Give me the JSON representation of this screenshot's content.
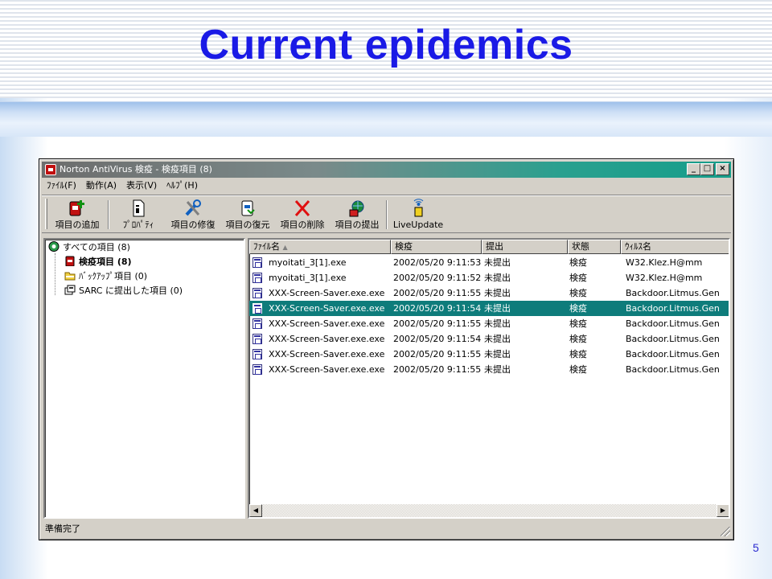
{
  "slide": {
    "title": "Current epidemics",
    "page_number": "5"
  },
  "window": {
    "title": "Norton AntiVirus 検疫 - 検疫項目 (8)",
    "controls": {
      "minimize": "_",
      "maximize": "□",
      "close": "×"
    }
  },
  "menu": [
    {
      "label": "ﾌｧｲﾙ(F)"
    },
    {
      "label": "動作(A)"
    },
    {
      "label": "表示(V)"
    },
    {
      "label": "ﾍﾙﾌﾟ(H)"
    }
  ],
  "toolbar": {
    "add": "項目の追加",
    "properties": "ﾌﾟﾛﾊﾟﾃｨ",
    "repair": "項目の修復",
    "restore": "項目の復元",
    "delete": "項目の削除",
    "submit": "項目の提出",
    "liveupdate": "LiveUpdate"
  },
  "tree": [
    {
      "label": "すべての項目 (8)",
      "icon": "all-items-icon"
    },
    {
      "label": "検疫項目 (8)",
      "icon": "quarantine-icon"
    },
    {
      "label": "ﾊﾞｯｸｱｯﾌﾟ項目 (0)",
      "icon": "backup-folder-icon"
    },
    {
      "label": "SARC に提出した項目 (0)",
      "icon": "submitted-icon"
    }
  ],
  "list": {
    "columns": [
      "ﾌｧｲﾙ名",
      "検疫",
      "提出",
      "状態",
      "ｳｨﾙｽ名"
    ],
    "sort_indicator": "▲",
    "rows": [
      {
        "file": "myoitati_3[1].exe",
        "date": "2002/05/20 9:11:53",
        "submitted": "未提出",
        "status": "検疫",
        "virus": "W32.Klez.H@mm",
        "selected": false
      },
      {
        "file": "myoitati_3[1].exe",
        "date": "2002/05/20 9:11:52",
        "submitted": "未提出",
        "status": "検疫",
        "virus": "W32.Klez.H@mm",
        "selected": false
      },
      {
        "file": "XXX-Screen-Saver.exe.exe",
        "date": "2002/05/20 9:11:55",
        "submitted": "未提出",
        "status": "検疫",
        "virus": "Backdoor.Litmus.Gen",
        "selected": false
      },
      {
        "file": "XXX-Screen-Saver.exe.exe",
        "date": "2002/05/20 9:11:54",
        "submitted": "未提出",
        "status": "検疫",
        "virus": "Backdoor.Litmus.Gen",
        "selected": true
      },
      {
        "file": "XXX-Screen-Saver.exe.exe",
        "date": "2002/05/20 9:11:55",
        "submitted": "未提出",
        "status": "検疫",
        "virus": "Backdoor.Litmus.Gen",
        "selected": false
      },
      {
        "file": "XXX-Screen-Saver.exe.exe",
        "date": "2002/05/20 9:11:54",
        "submitted": "未提出",
        "status": "検疫",
        "virus": "Backdoor.Litmus.Gen",
        "selected": false
      },
      {
        "file": "XXX-Screen-Saver.exe.exe",
        "date": "2002/05/20 9:11:55",
        "submitted": "未提出",
        "status": "検疫",
        "virus": "Backdoor.Litmus.Gen",
        "selected": false
      },
      {
        "file": "XXX-Screen-Saver.exe.exe",
        "date": "2002/05/20 9:11:55",
        "submitted": "未提出",
        "status": "検疫",
        "virus": "Backdoor.Litmus.Gen",
        "selected": false
      }
    ]
  },
  "scrollbar": {
    "left_arrow": "◀",
    "right_arrow": "▶"
  },
  "status": "準備完了",
  "colors": {
    "title_text": "#1a1ae6",
    "selection": "#0e7c7b",
    "delete_x": "#e01010"
  }
}
